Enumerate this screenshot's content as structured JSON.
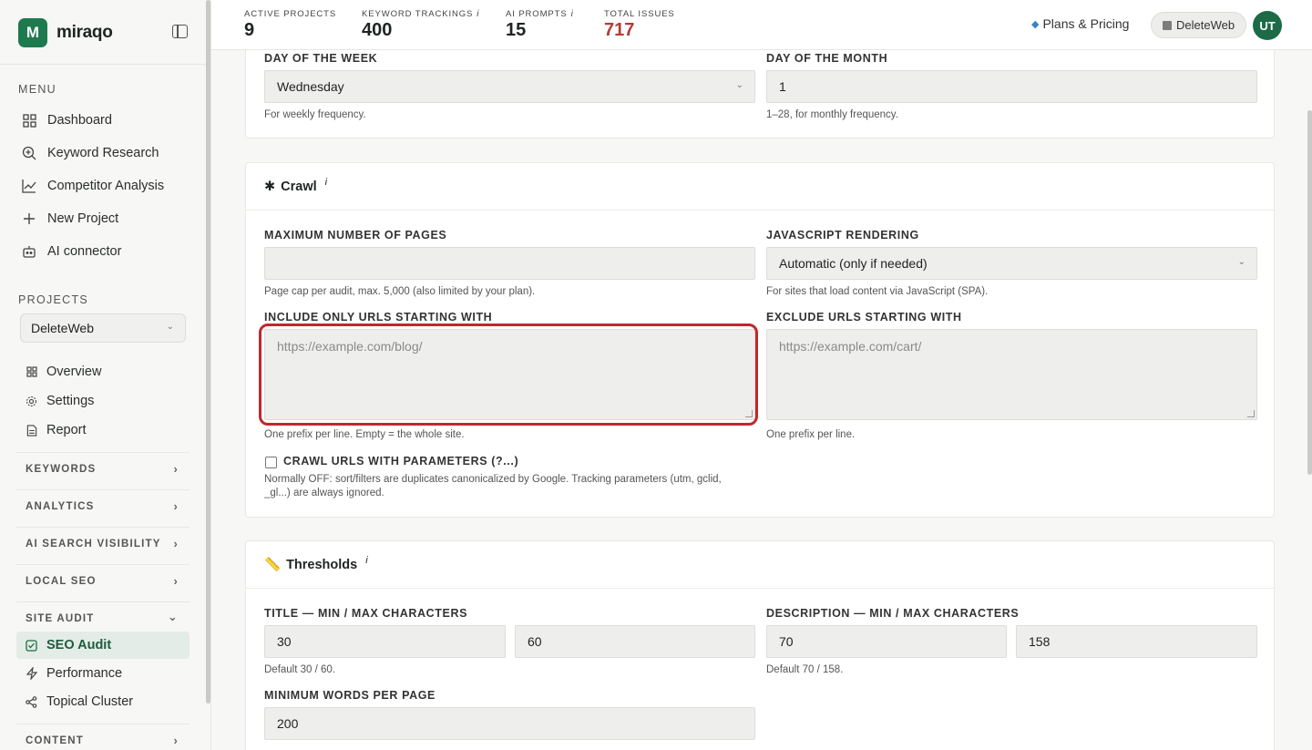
{
  "brand": {
    "name": "miraqo",
    "logo_letter": "M"
  },
  "sidebar": {
    "menu_label": "MENU",
    "menu": [
      {
        "label": "Dashboard",
        "icon": "grid-icon"
      },
      {
        "label": "Keyword Research",
        "icon": "search-plus-icon"
      },
      {
        "label": "Competitor Analysis",
        "icon": "chart-line-icon"
      },
      {
        "label": "New Project",
        "icon": "plus-icon"
      },
      {
        "label": "AI connector",
        "icon": "robot-icon"
      }
    ],
    "projects_label": "PROJECTS",
    "project_selected": "DeleteWeb",
    "project_items": [
      {
        "label": "Overview",
        "icon": "grid-icon"
      },
      {
        "label": "Settings",
        "icon": "gear-icon"
      },
      {
        "label": "Report",
        "icon": "document-icon"
      }
    ],
    "sections": [
      {
        "label": "KEYWORDS"
      },
      {
        "label": "ANALYTICS"
      },
      {
        "label": "AI SEARCH VISIBILITY"
      },
      {
        "label": "LOCAL SEO"
      },
      {
        "label": "SITE AUDIT"
      },
      {
        "label": "CONTENT"
      }
    ],
    "site_audit_items": [
      {
        "label": "SEO Audit",
        "icon": "check-square-icon",
        "active": true
      },
      {
        "label": "Performance",
        "icon": "lightning-icon"
      },
      {
        "label": "Topical Cluster",
        "icon": "share-icon"
      }
    ]
  },
  "topbar": {
    "stats": [
      {
        "label": "ACTIVE PROJECTS",
        "value": "9"
      },
      {
        "label": "KEYWORD TRACKINGS",
        "value": "400",
        "info": "i"
      },
      {
        "label": "AI PROMPTS",
        "value": "15",
        "info": "i"
      },
      {
        "label": "TOTAL ISSUES",
        "value": "717"
      }
    ],
    "plans_label": "Plans & Pricing",
    "workspace": "DeleteWeb",
    "avatar_initials": "UT"
  },
  "schedule": {
    "day_of_week_label": "DAY OF THE WEEK",
    "day_of_week_value": "Wednesday",
    "day_of_week_help": "For weekly frequency.",
    "day_of_month_label": "DAY OF THE MONTH",
    "day_of_month_value": "1",
    "day_of_month_help": "1–28, for monthly frequency."
  },
  "crawl": {
    "title": "Crawl",
    "icon": "spider-icon",
    "info": "i",
    "max_pages_label": "MAXIMUM NUMBER OF PAGES",
    "max_pages_value": "",
    "max_pages_help": "Page cap per audit, max. 5,000 (also limited by your plan).",
    "js_label": "JAVASCRIPT RENDERING",
    "js_value": "Automatic (only if needed)",
    "js_help": "For sites that load content via JavaScript (SPA).",
    "include_label": "INCLUDE ONLY URLS STARTING WITH",
    "include_placeholder": "https://example.com/blog/",
    "include_help": "One prefix per line. Empty = the whole site.",
    "exclude_label": "EXCLUDE URLS STARTING WITH",
    "exclude_placeholder": "https://example.com/cart/",
    "exclude_help": "One prefix per line.",
    "params_label": "CRAWL URLS WITH PARAMETERS (?...)",
    "params_help_1": "Normally OFF: sort/filters are duplicates canonicalized by Google. Tracking parameters (utm, gclid,",
    "params_help_2": "_gl...) are always ignored."
  },
  "thresholds": {
    "title": "Thresholds",
    "icon": "ruler-icon",
    "info": "i",
    "title_chars_label": "TITLE — MIN / MAX CHARACTERS",
    "title_min": "30",
    "title_max": "60",
    "title_help": "Default 30 / 60.",
    "desc_chars_label": "DESCRIPTION — MIN / MAX CHARACTERS",
    "desc_min": "70",
    "desc_max": "158",
    "desc_help": "Default 70 / 158.",
    "min_words_label": "MINIMUM WORDS PER PAGE",
    "min_words_value": "200"
  },
  "colors": {
    "brand": "#1d7a4f",
    "issues": "#b53a3a",
    "highlight": "#c0282c"
  }
}
